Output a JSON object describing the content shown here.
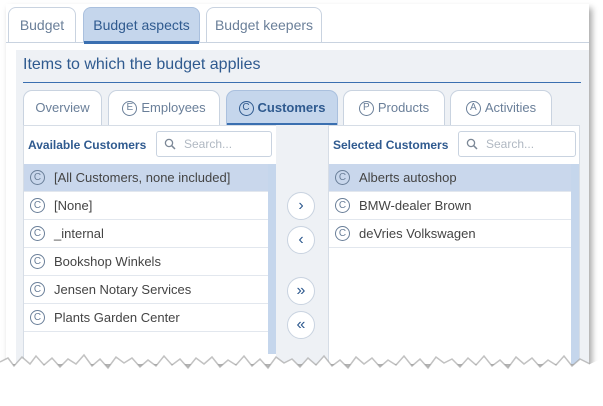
{
  "outer_tabs": [
    {
      "label": "Budget"
    },
    {
      "label": "Budget aspects"
    },
    {
      "label": "Budget keepers"
    }
  ],
  "section_title": "Items to which the budget applies",
  "inner_tabs": [
    {
      "label": "Overview",
      "icon_letter": ""
    },
    {
      "label": "Employees",
      "icon_letter": "E"
    },
    {
      "label": "Customers",
      "icon_letter": "C"
    },
    {
      "label": "Products",
      "icon_letter": "P"
    },
    {
      "label": "Activities",
      "icon_letter": "A"
    }
  ],
  "available": {
    "title": "Available Customers",
    "search_placeholder": "Search...",
    "items": [
      {
        "letter": "C",
        "label": "[All Customers, none included]"
      },
      {
        "letter": "C",
        "label": "[None]"
      },
      {
        "letter": "C",
        "label": "_internal"
      },
      {
        "letter": "C",
        "label": "Bookshop Winkels"
      },
      {
        "letter": "C",
        "label": "Jensen Notary Services"
      },
      {
        "letter": "C",
        "label": "Plants Garden Center"
      }
    ]
  },
  "selected": {
    "title": "Selected Customers",
    "search_placeholder": "Search...",
    "items": [
      {
        "letter": "C",
        "label": "Alberts autoshop"
      },
      {
        "letter": "C",
        "label": "BMW-dealer Brown"
      },
      {
        "letter": "C",
        "label": "deVries Volkswagen"
      }
    ]
  },
  "move_buttons": {
    "add": "›",
    "remove": "‹",
    "add_all": "»",
    "remove_all": "«"
  },
  "colors": {
    "accent": "#2f5a8f",
    "active_tab_bg": "#c5d6ec",
    "selected_row_bg": "#c9d7ec"
  }
}
